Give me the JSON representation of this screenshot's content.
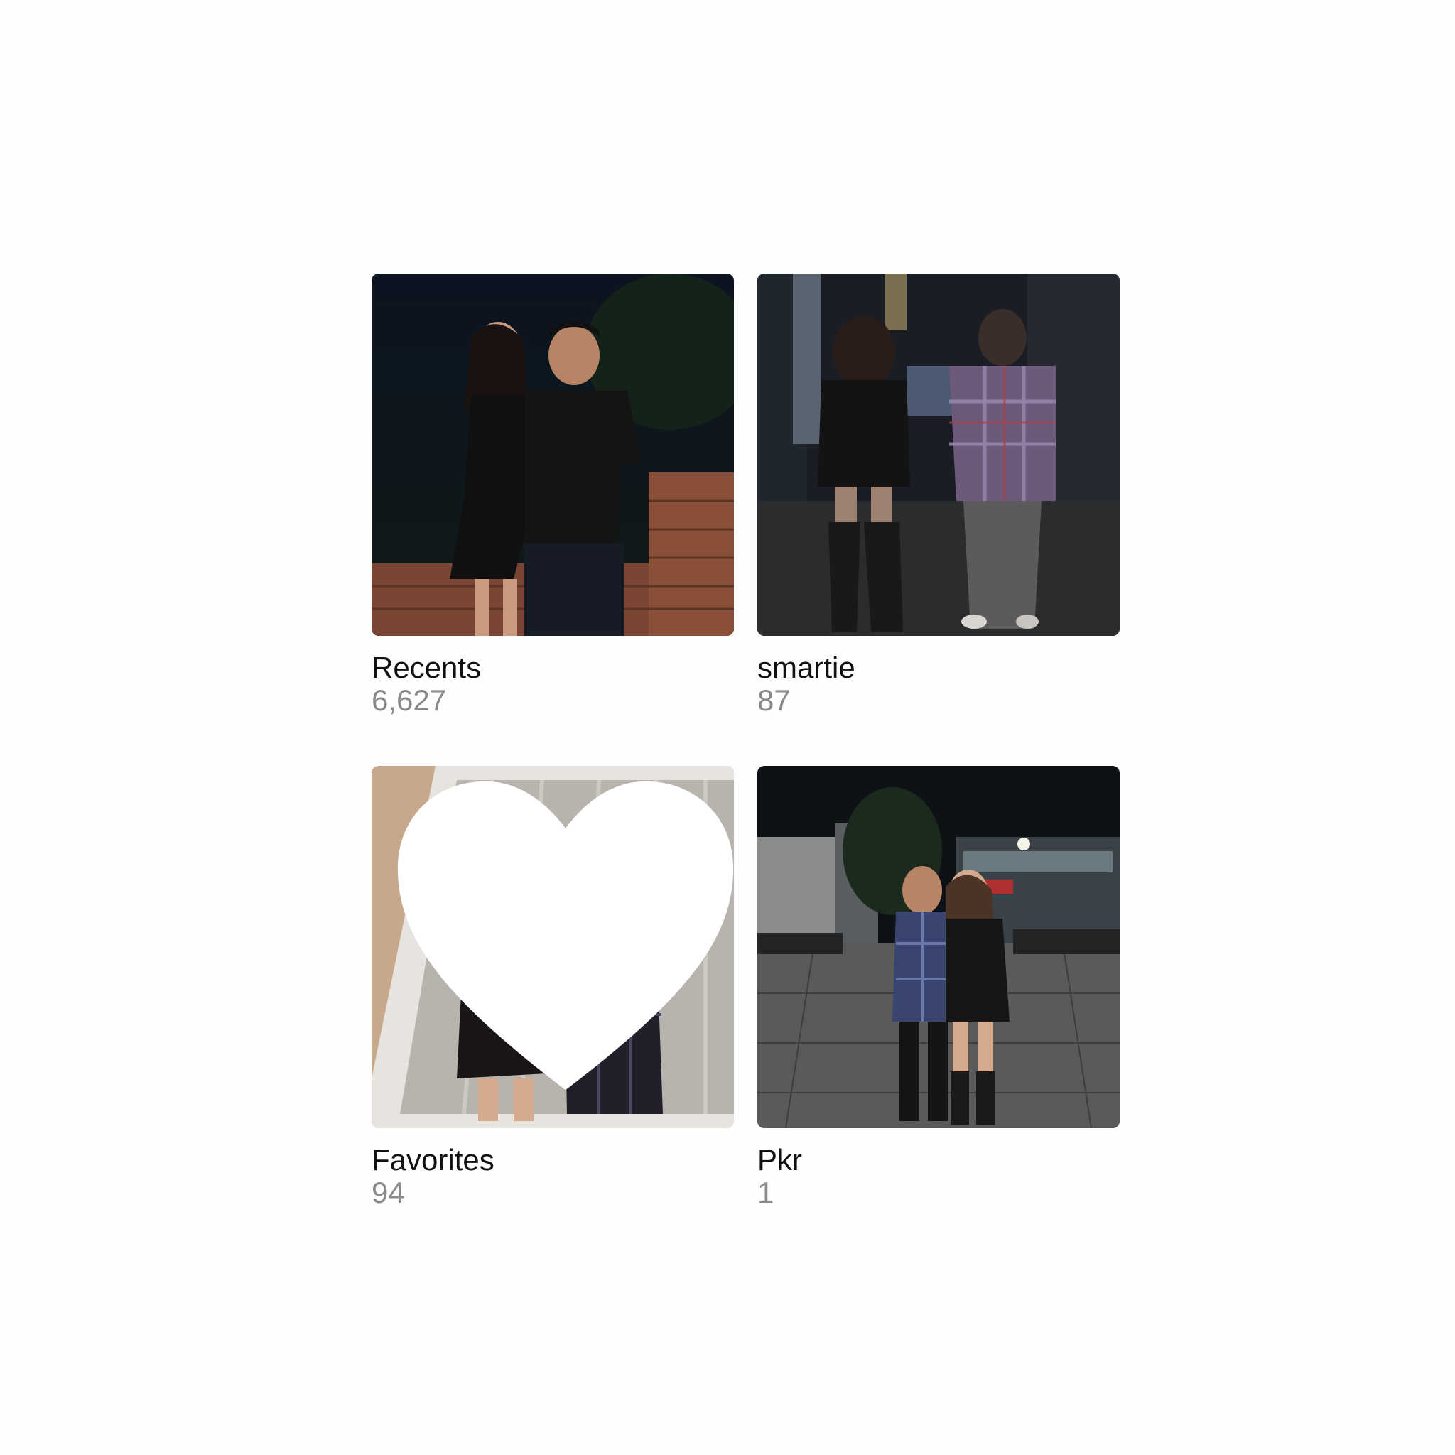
{
  "albums": [
    {
      "title": "Recents",
      "count": "6,627",
      "thumb_desc": "couple-night-photo"
    },
    {
      "title": "smartie",
      "count": "87",
      "thumb_desc": "couple-walking-street"
    },
    {
      "title": "Favorites",
      "count": "94",
      "thumb_desc": "polaroid-couple-photo",
      "favorite_icon": "heart-icon"
    },
    {
      "title": "Pkr",
      "count": "1",
      "thumb_desc": "couple-street-night-photo"
    }
  ],
  "colors": {
    "background": "#fefefe",
    "title": "#111111",
    "count": "#8a8a8a"
  }
}
